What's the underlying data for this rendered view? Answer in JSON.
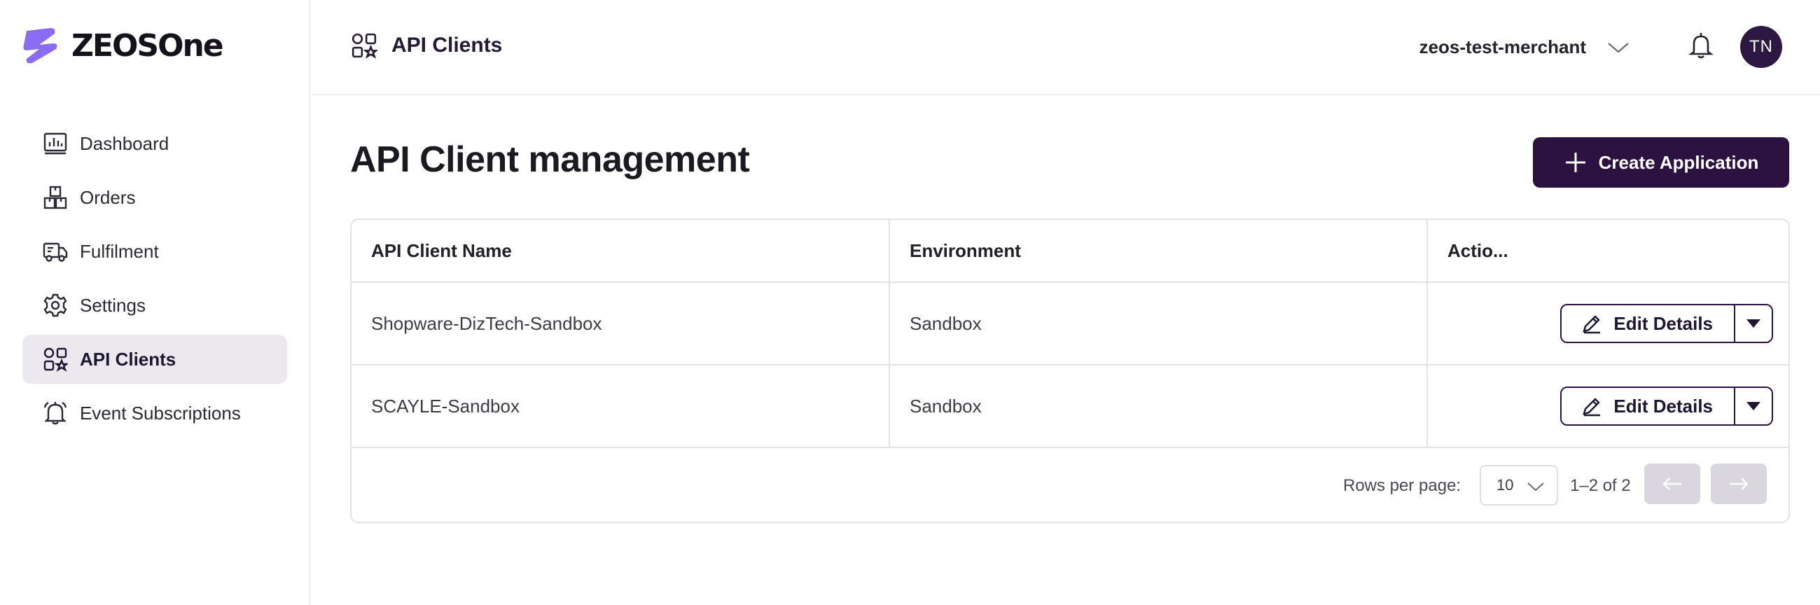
{
  "brand": {
    "name_main": "ZEOS",
    "name_sub": "One",
    "accent": "#2c1240"
  },
  "sidebar": {
    "items": [
      {
        "label": "Dashboard",
        "icon": "dashboard-icon",
        "active": false
      },
      {
        "label": "Orders",
        "icon": "boxes-icon",
        "active": false
      },
      {
        "label": "Fulfilment",
        "icon": "truck-icon",
        "active": false
      },
      {
        "label": "Settings",
        "icon": "gear-icon",
        "active": false
      },
      {
        "label": "API Clients",
        "icon": "api-clients-icon",
        "active": true
      },
      {
        "label": "Event Subscriptions",
        "icon": "bell-icon",
        "active": false
      }
    ]
  },
  "header": {
    "title": "API Clients",
    "merchant": "zeos-test-merchant",
    "avatar_initials": "TN"
  },
  "main": {
    "title": "API Client management",
    "create_label": "Create Application",
    "table": {
      "columns": [
        "API Client Name",
        "Environment",
        "Actio..."
      ],
      "rows": [
        {
          "name": "Shopware-DizTech-Sandbox",
          "environment": "Sandbox",
          "action_label": "Edit Details"
        },
        {
          "name": "SCAYLE-Sandbox",
          "environment": "Sandbox",
          "action_label": "Edit Details"
        }
      ]
    },
    "pagination": {
      "rows_per_page_label": "Rows per page:",
      "rows_per_page_value": "10",
      "range": "1–2 of 2"
    }
  }
}
